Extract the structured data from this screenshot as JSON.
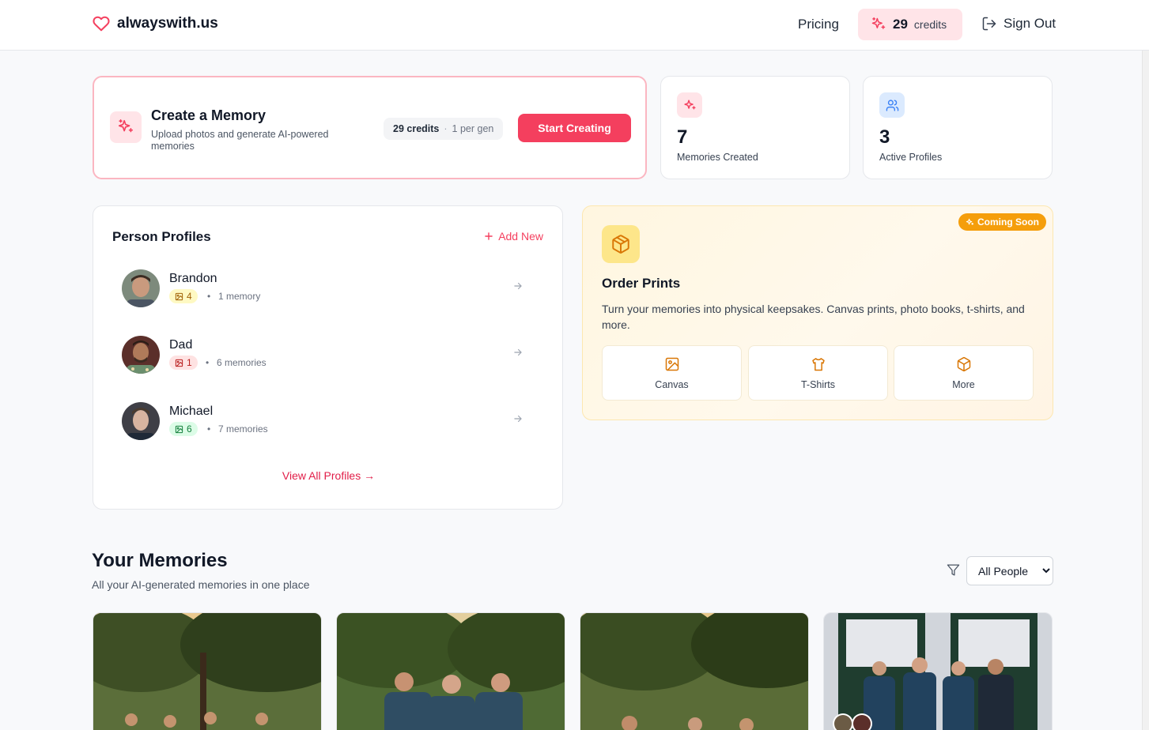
{
  "header": {
    "logo_text": "alwayswith.us",
    "pricing_label": "Pricing",
    "credits_count": "29",
    "credits_label": "credits",
    "signout_label": "Sign Out"
  },
  "create": {
    "title": "Create a Memory",
    "description": "Upload photos and generate AI-powered memories",
    "credits_chip": "29 credits",
    "per_gen": "1 per gen",
    "button": "Start Creating"
  },
  "stats": [
    {
      "value": "7",
      "label": "Memories Created"
    },
    {
      "value": "3",
      "label": "Active Profiles"
    }
  ],
  "profiles": {
    "title": "Person Profiles",
    "add_new": "Add New",
    "view_all": "View All Profiles →",
    "items": [
      {
        "name": "Brandon",
        "photos": "4",
        "memories": "1 memory"
      },
      {
        "name": "Dad",
        "photos": "1",
        "memories": "6 memories"
      },
      {
        "name": "Michael",
        "photos": "6",
        "memories": "7 memories"
      }
    ]
  },
  "prints": {
    "badge": "Coming Soon",
    "title": "Order Prints",
    "description": "Turn your memories into physical keepsakes. Canvas prints, photo books, t-shirts, and more.",
    "options": [
      "Canvas",
      "T-Shirts",
      "More"
    ]
  },
  "memories": {
    "title": "Your Memories",
    "subtitle": "All your AI-generated memories in one place",
    "filter_selected": "All People"
  },
  "colors": {
    "accent": "#f43f5e",
    "accent_light": "#ffe4e8",
    "amber": "#f59e0b"
  }
}
